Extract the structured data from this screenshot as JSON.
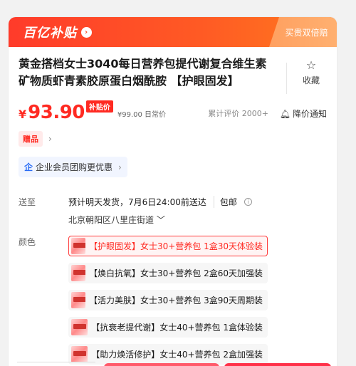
{
  "banner": {
    "logo_text": "百亿补贴",
    "logo_arrow": "›",
    "right_text": "买贵双倍赔"
  },
  "product": {
    "title": "黄金搭档女士3040每日营养包提代谢复合维生素矿物质虾青素胶原蛋白烟酰胺 【护眼固发】",
    "favorite_label": "收藏",
    "favorite_icon": "star-outline-icon"
  },
  "price": {
    "currency": "¥",
    "value": "93.90",
    "badge": "补贴价",
    "original": "¥99.00 日常价",
    "reviews": "累计评价 2000+",
    "notify_label": "降价通知",
    "accent": "#ff2a22"
  },
  "gift": {
    "tag": "赠品",
    "arrow": "›"
  },
  "corp": {
    "icon": "企",
    "label": "企业会员团购更优惠",
    "arrow": "›"
  },
  "shipping": {
    "label": "送至",
    "eta": "预计明天发货，7月6日24:00前送达",
    "free": "包邮",
    "info_icon": "i",
    "address": "北京朝阳区八里庄街道"
  },
  "color": {
    "label": "颜色",
    "options": [
      {
        "text": "【护眼固发】女士30+营养包 1盒30天体验装",
        "selected": true
      },
      {
        "text": "【焕白抗氧】女士30+营养包 2盒60天加强装",
        "selected": false
      },
      {
        "text": "【活力美肤】女士30+营养包 3盒90天周期装",
        "selected": false
      },
      {
        "text": "【抗衰老提代谢】女士40+营养包 1盒体验装",
        "selected": false
      },
      {
        "text": "【助力焕活修护】女士40+营养包 2盒加强装",
        "selected": false
      }
    ]
  }
}
